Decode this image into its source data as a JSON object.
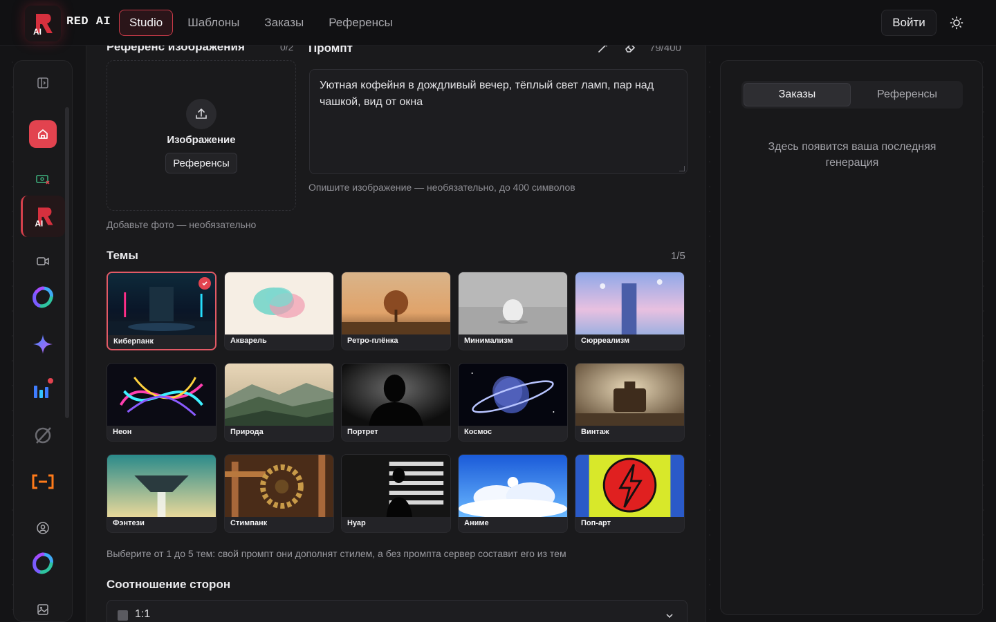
{
  "header": {
    "brand": "RED AI",
    "logo_text": "AI",
    "nav": [
      {
        "label": "Studio",
        "active": true
      },
      {
        "label": "Шаблоны",
        "active": false
      },
      {
        "label": "Заказы",
        "active": false
      },
      {
        "label": "Референсы",
        "active": false
      }
    ],
    "login_label": "Войти",
    "theme_toggle_icon": "sun-icon"
  },
  "sidebar": {
    "items": [
      {
        "icon": "panel-toggle-icon"
      },
      {
        "icon": "home-icon",
        "active": true
      },
      {
        "icon": "money-icon"
      },
      {
        "icon": "red-ai-logo-icon",
        "label": "AI"
      },
      {
        "icon": "video-camera-icon"
      },
      {
        "icon": "swirl-app-icon"
      },
      {
        "icon": "sparkle-icon"
      },
      {
        "icon": "chart-bars-icon"
      },
      {
        "icon": "no-sign-icon"
      },
      {
        "icon": "brackets-icon"
      },
      {
        "icon": "user-circle-icon"
      },
      {
        "icon": "swirl-app-icon"
      },
      {
        "icon": "image-icon"
      }
    ]
  },
  "reference": {
    "title": "Референс изображения",
    "count": "0/2",
    "upload_label": "Изображение",
    "upload_button": "Референсы",
    "hint": "Добавьте фото — необязательно"
  },
  "prompt": {
    "title": "Промпт",
    "count": "79/400",
    "value": "Уютная кофейня в дождливый вечер, тёплый свет ламп, пар над чашкой, вид от окна",
    "hint": "Опишите изображение — необязательно, до 400 символов"
  },
  "themes": {
    "title": "Темы",
    "count": "1/5",
    "items": [
      {
        "label": "Киберпанк",
        "selected": true
      },
      {
        "label": "Акварель",
        "selected": false
      },
      {
        "label": "Ретро-плёнка",
        "selected": false
      },
      {
        "label": "Минимализм",
        "selected": false
      },
      {
        "label": "Сюрреализм",
        "selected": false
      },
      {
        "label": "Неон",
        "selected": false
      },
      {
        "label": "Природа",
        "selected": false
      },
      {
        "label": "Портрет",
        "selected": false
      },
      {
        "label": "Космос",
        "selected": false
      },
      {
        "label": "Винтаж",
        "selected": false
      },
      {
        "label": "Фэнтези",
        "selected": false
      },
      {
        "label": "Стимпанк",
        "selected": false
      },
      {
        "label": "Нуар",
        "selected": false
      },
      {
        "label": "Аниме",
        "selected": false
      },
      {
        "label": "Поп-арт",
        "selected": false
      }
    ],
    "hint": "Выберите от 1 до 5 тем: свой промпт они дополнят стилем, а без промпта сервер составит его из тем"
  },
  "aspect": {
    "title": "Соотношение сторон",
    "value": "1:1"
  },
  "right_panel": {
    "tabs": [
      {
        "label": "Заказы",
        "active": true
      },
      {
        "label": "Референсы",
        "active": false
      }
    ],
    "empty_text": "Здесь появится ваша последняя генерация"
  },
  "colors": {
    "accent": "#e2434f",
    "background": "#141416",
    "panel": "#1a1a1c"
  }
}
